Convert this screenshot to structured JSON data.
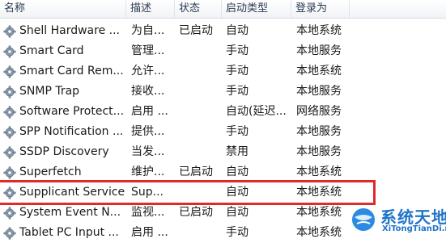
{
  "columns": {
    "name": "名称",
    "description": "描述",
    "status": "状态",
    "startup_type": "启动类型",
    "logon_as": "登录为"
  },
  "rows": [
    {
      "name": "Shell Hardware ...",
      "description": "为自...",
      "status": "已启动",
      "startup_type": "自动",
      "logon_as": "本地系统"
    },
    {
      "name": "Smart Card",
      "description": "管理...",
      "status": "",
      "startup_type": "手动",
      "logon_as": "本地服务"
    },
    {
      "name": "Smart Card Rem...",
      "description": "允许...",
      "status": "",
      "startup_type": "手动",
      "logon_as": "本地系统"
    },
    {
      "name": "SNMP Trap",
      "description": "接收...",
      "status": "",
      "startup_type": "手动",
      "logon_as": "本地服务"
    },
    {
      "name": "Software Protect...",
      "description": "启用 ...",
      "status": "",
      "startup_type": "自动(延迟...",
      "logon_as": "网络服务"
    },
    {
      "name": "SPP Notification ...",
      "description": "提供...",
      "status": "",
      "startup_type": "手动",
      "logon_as": "本地服务"
    },
    {
      "name": "SSDP Discovery",
      "description": "当发...",
      "status": "",
      "startup_type": "禁用",
      "logon_as": "本地服务"
    },
    {
      "name": "Superfetch",
      "description": "维护...",
      "status": "已启动",
      "startup_type": "自动",
      "logon_as": "本地系统"
    },
    {
      "name": "Supplicant Service",
      "description": "Sup...",
      "status": "",
      "startup_type": "自动",
      "logon_as": "本地系统"
    },
    {
      "name": "System Event N...",
      "description": "监视...",
      "status": "已启动",
      "startup_type": "自动",
      "logon_as": "本地系统"
    },
    {
      "name": "Tablet PC Input ...",
      "description": "启用 ...",
      "status": "",
      "startup_type": "手动",
      "logon_as": "本地系统"
    }
  ],
  "watermark": {
    "title": "系统天地",
    "url": "XiTongTianDi.net"
  },
  "colors": {
    "highlight_box": "#e02a2a",
    "watermark_blue": "#1f74c8"
  }
}
